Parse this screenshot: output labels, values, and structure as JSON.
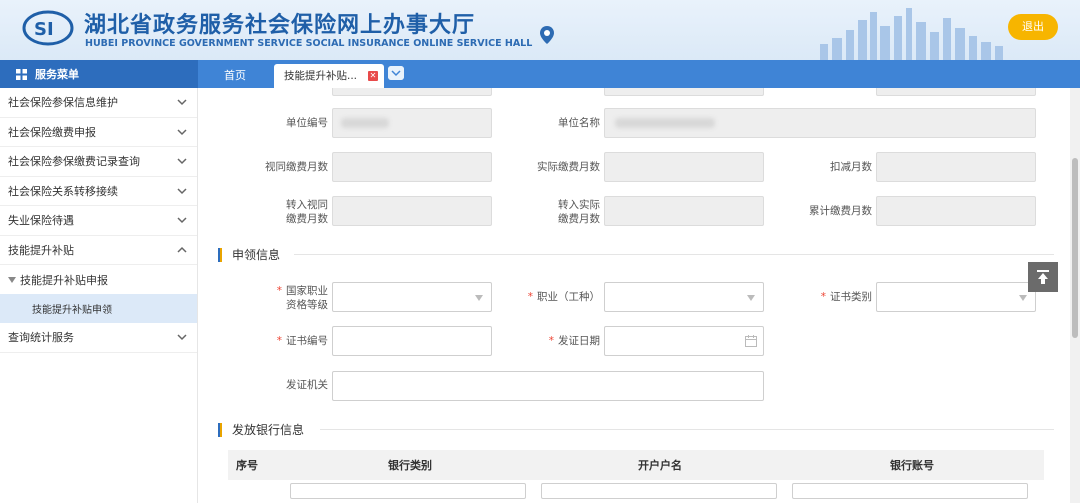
{
  "header": {
    "title_cn": "湖北省政务服务社会保险网上办事大厅",
    "title_en": "HUBEI PROVINCE GOVERNMENT SERVICE SOCIAL INSURANCE ONLINE SERVICE HALL",
    "logout_label": "退出",
    "logo_icon": "si-logo-icon",
    "location_icon": "location-pin-icon"
  },
  "nav": {
    "menu_title": "服务菜单",
    "tabs": [
      {
        "label": "首页"
      },
      {
        "label": "技能提升补贴..."
      }
    ]
  },
  "sidebar": {
    "items": [
      {
        "label": "社会保险参保信息维护"
      },
      {
        "label": "社会保险缴费申报"
      },
      {
        "label": "社会保险参保缴费记录查询"
      },
      {
        "label": "社会保险关系转移接续"
      },
      {
        "label": "失业保险待遇"
      },
      {
        "label": "技能提升补贴"
      },
      {
        "label": "查询统计服务"
      }
    ],
    "sub": {
      "label": "技能提升补贴申报"
    },
    "leaf": {
      "label": "技能提升补贴申领"
    }
  },
  "form": {
    "unit_no": "单位编号",
    "unit_name": "单位名称",
    "deemed_months": "视同缴费月数",
    "actual_months": "实际缴费月数",
    "deduct_months": "扣减月数",
    "transfer_deemed_1": "转入视同",
    "transfer_deemed_2": "缴费月数",
    "transfer_actual_1": "转入实际",
    "transfer_actual_2": "缴费月数",
    "total_months": "累计缴费月数",
    "apply_section": "申领信息",
    "qualification_1": "国家职业",
    "qualification_2": "资格等级",
    "occupation": "职业（工种）",
    "cert_type": "证书类别",
    "cert_no": "证书编号",
    "issue_date": "发证日期",
    "issuer": "发证机关",
    "bank_section": "发放银行信息",
    "required_mark": "*"
  },
  "bank_table": {
    "headers": [
      "序号",
      "银行类别",
      "开户户名",
      "银行账号"
    ]
  },
  "colors": {
    "accent": "#3f84d6",
    "logout": "#f7b500",
    "required": "#ee4433"
  }
}
